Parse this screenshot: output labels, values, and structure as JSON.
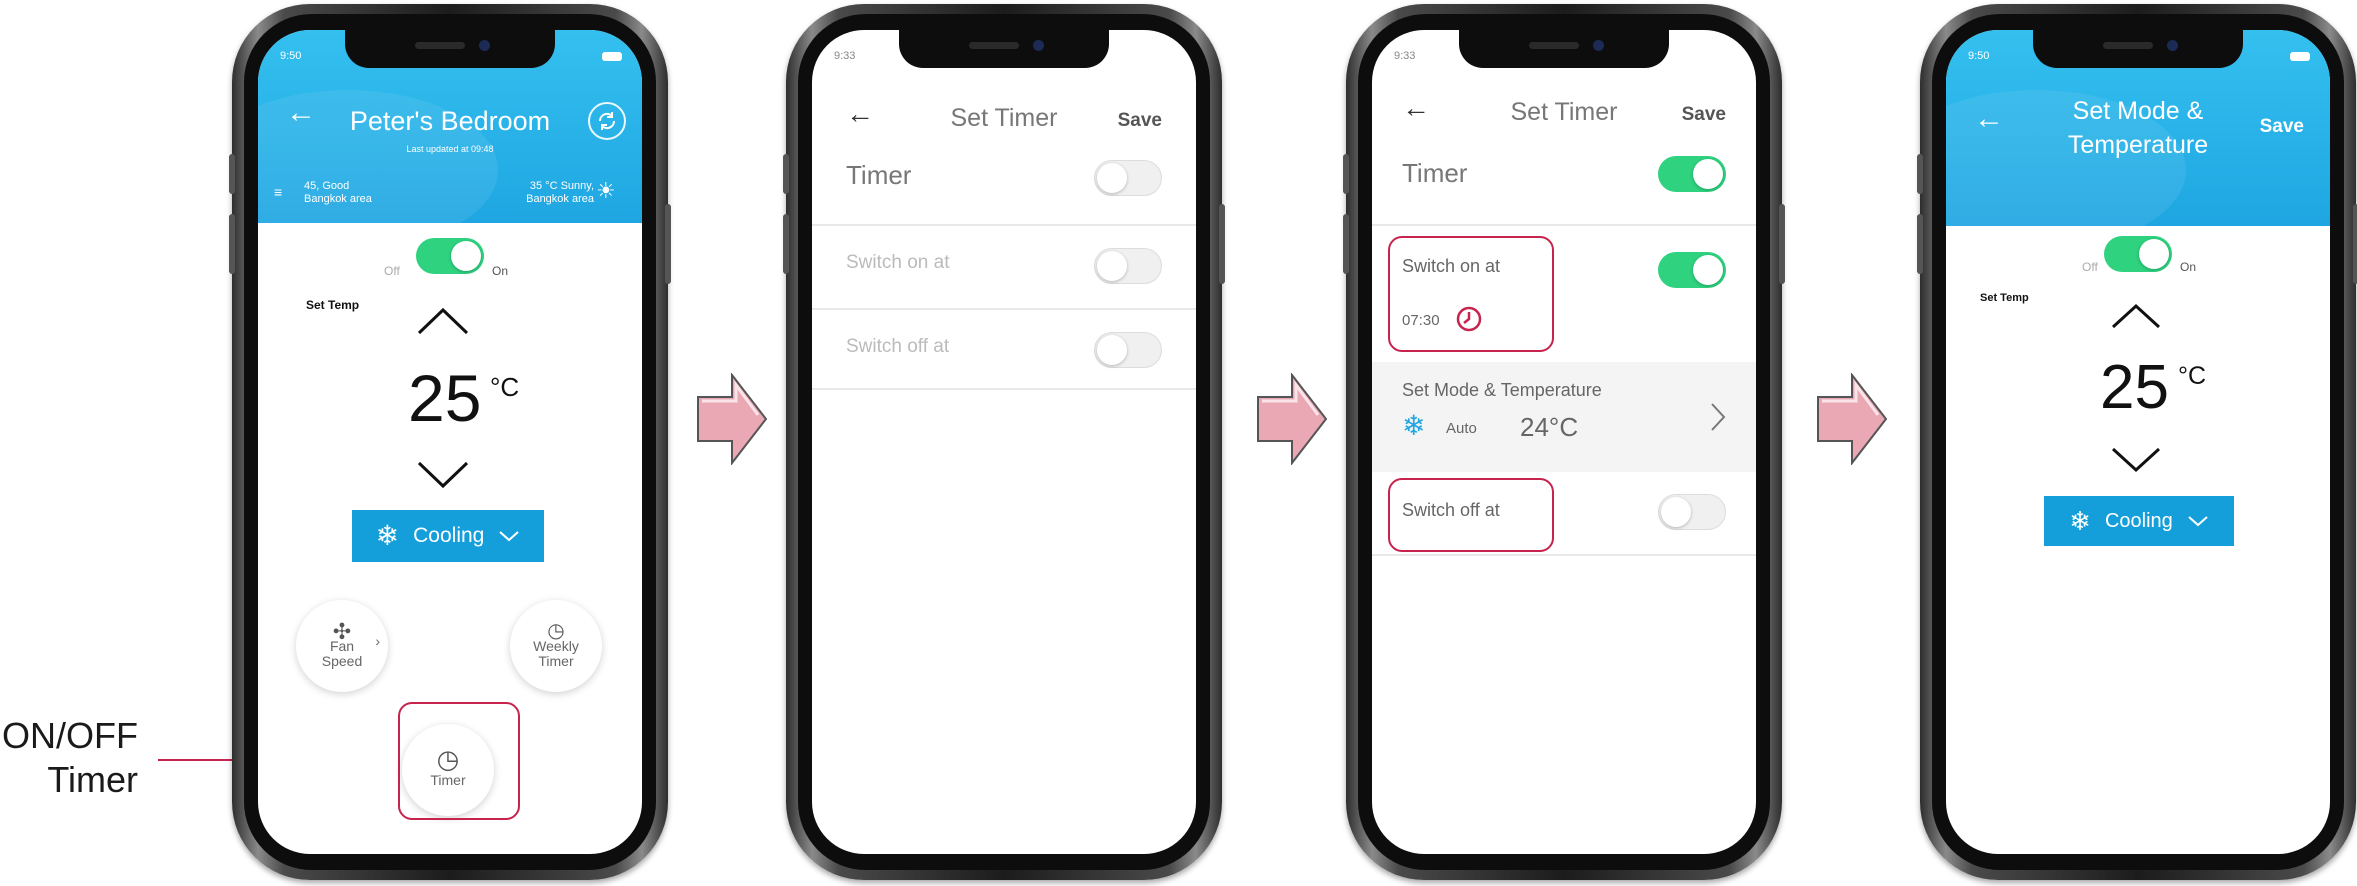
{
  "callout": {
    "text_line1": "ON/OFF",
    "text_line2": "Timer"
  },
  "screen1": {
    "status_time": "9:50",
    "title": "Peter's Bedroom",
    "subtitle": "Last updated at 09:48",
    "air_quality": "45, Good",
    "air_area": "Bangkok area",
    "weather": "35 °C Sunny,",
    "weather_area": "Bangkok area",
    "power_off_label": "Off",
    "power_on_label": "On",
    "set_temp_label": "Set Temp",
    "temperature": "25",
    "unit": "°C",
    "mode_label": "Cooling",
    "fan_label_1": "Fan",
    "fan_label_2": "Speed",
    "weekly_label_1": "Weekly",
    "weekly_label_2": "Timer",
    "timer_label": "Timer"
  },
  "screen2": {
    "status_time": "9:33",
    "title": "Set Timer",
    "save": "Save",
    "timer_label": "Timer",
    "switch_on_label": "Switch on at",
    "switch_off_label": "Switch off at"
  },
  "screen3": {
    "status_time": "9:33",
    "title": "Set Timer",
    "save": "Save",
    "timer_label": "Timer",
    "switch_on_label": "Switch on at",
    "switch_on_time": "07:30",
    "mode_title": "Set Mode & Temperature",
    "mode_value": "Auto",
    "mode_temp": "24°C",
    "switch_off_label": "Switch off at"
  },
  "screen4": {
    "status_time": "9:50",
    "title_line1": "Set Mode &",
    "title_line2": "Temperature",
    "save": "Save",
    "power_off_label": "Off",
    "power_on_label": "On",
    "set_temp_label": "Set Temp",
    "temperature": "25",
    "unit": "°C",
    "mode_label": "Cooling"
  },
  "colors": {
    "brand_blue": "#149fdb",
    "toggle_on": "#2ed27f",
    "highlight": "#c8234d",
    "arrow": "#e9a8b4"
  }
}
